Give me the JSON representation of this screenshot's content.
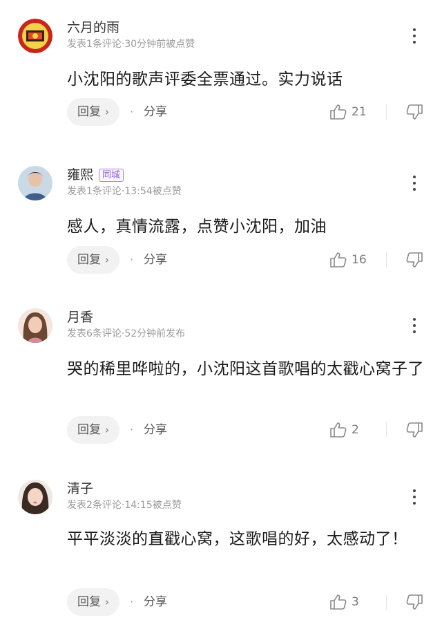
{
  "comments": [
    {
      "user": "六月的雨",
      "badge": "",
      "meta": "发表1条评论·30分钟前被点赞",
      "text": "小沈阳的歌声评委全票通过。实力说话",
      "reply_label": "回复",
      "share_label": "分享",
      "likes": "21"
    },
    {
      "user": "雍熙",
      "badge": "同城",
      "meta": "发表1条评论·13:54被点赞",
      "text": "感人，真情流露，点赞小沈阳，加油",
      "reply_label": "回复",
      "share_label": "分享",
      "likes": "16"
    },
    {
      "user": "月香",
      "badge": "",
      "meta": "发表6条评论·52分钟前发布",
      "text": "哭的稀里哗啦的，小沈阳这首歌唱的太戳心窝子了",
      "reply_label": "回复",
      "share_label": "分享",
      "likes": "2"
    },
    {
      "user": "清子",
      "badge": "",
      "meta": "发表2条评论·14:15被点赞",
      "text": "平平淡淡的直戳心窝，这歌唱的好，太感动了！",
      "reply_label": "回复",
      "share_label": "分享",
      "likes": "3"
    }
  ],
  "icons": {
    "more": "more-vertical-icon",
    "reply_arrow": "chevron-right-icon",
    "like": "thumbs-up-icon",
    "dislike": "thumbs-down-icon"
  },
  "colors": {
    "badge_border": "#a983d8",
    "badge_text": "#8b5fcf",
    "meta_text": "#9a9a9a",
    "reply_bg": "#f2f2f2"
  }
}
